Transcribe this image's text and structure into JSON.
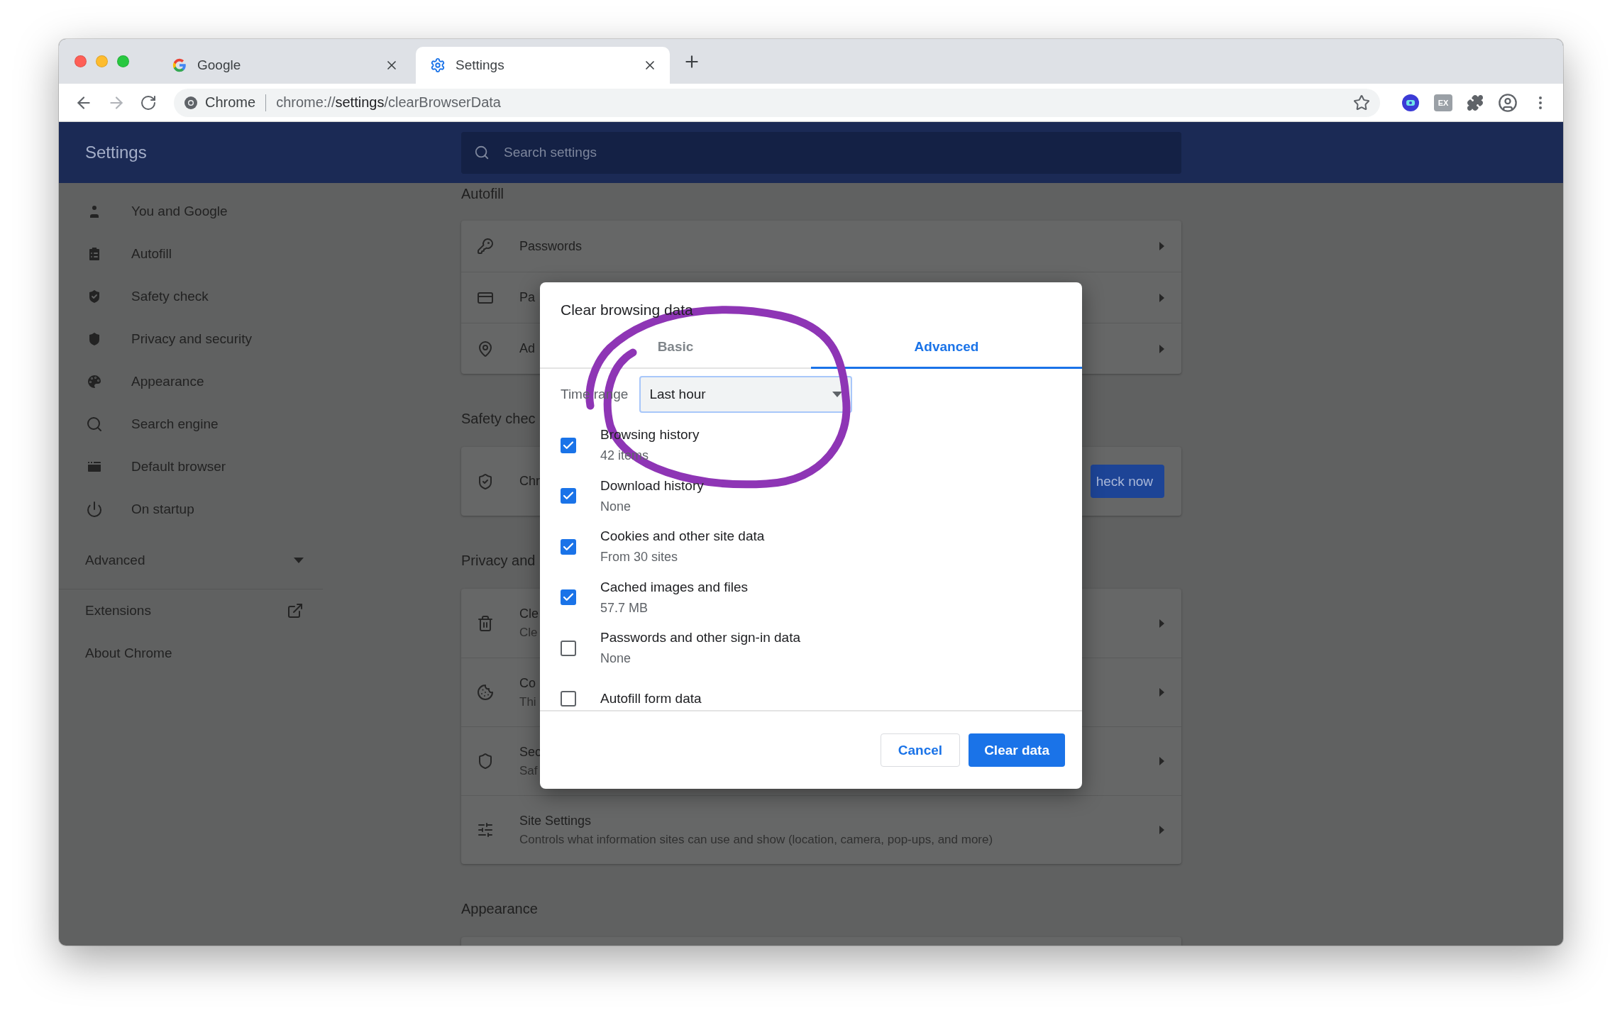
{
  "browser": {
    "tabs": [
      {
        "title": "Google",
        "selected": false
      },
      {
        "title": "Settings",
        "selected": true
      }
    ],
    "omnibox": {
      "chip": "Chrome",
      "url": {
        "scheme": "chrome://",
        "host": "settings",
        "path": "/clearBrowserData"
      }
    },
    "extension_badge": "EX"
  },
  "header": {
    "title": "Settings",
    "search": {
      "placeholder": "Search settings"
    }
  },
  "sidebar": {
    "items": [
      "You and Google",
      "Autofill",
      "Safety check",
      "Privacy and security",
      "Appearance",
      "Search engine",
      "Default browser",
      "On startup"
    ],
    "advanced": {
      "label": "Advanced",
      "expanded": false
    },
    "links": [
      "Extensions",
      "About Chrome"
    ]
  },
  "sections": [
    {
      "heading": "Autofill",
      "rows": [
        {
          "title": "Passwords"
        },
        {
          "title": "Pa"
        },
        {
          "title": "Ad"
        }
      ]
    },
    {
      "heading": "Safety chec",
      "rows": [
        {
          "title": "Chr",
          "button": "heck now"
        }
      ]
    },
    {
      "heading": "Privacy and",
      "rows": [
        {
          "title": "Cle",
          "subtitle": "Cle"
        },
        {
          "title": "Co",
          "subtitle": "Thi"
        },
        {
          "title": "Sec",
          "subtitle": "Saf"
        },
        {
          "title": "Site Settings",
          "subtitle": "Controls what information sites can use and show (location, camera, pop-ups, and more)"
        }
      ]
    },
    {
      "heading": "Appearance"
    }
  ],
  "dialog": {
    "title": "Clear browsing data",
    "tabs": [
      {
        "label": "Basic",
        "selected": false
      },
      {
        "label": "Advanced",
        "selected": true
      }
    ],
    "time_range": {
      "label": "Time range",
      "value": "Last hour"
    },
    "items": [
      {
        "label": "Browsing history",
        "detail": "42 items",
        "checked": true
      },
      {
        "label": "Download history",
        "detail": "None",
        "checked": true
      },
      {
        "label": "Cookies and other site data",
        "detail": "From 30 sites",
        "checked": true
      },
      {
        "label": "Cached images and files",
        "detail": "57.7 MB",
        "checked": true
      },
      {
        "label": "Passwords and other sign-in data",
        "detail": "None",
        "checked": false
      },
      {
        "label": "Autofill form data",
        "checked": false
      }
    ],
    "buttons": {
      "cancel": "Cancel",
      "confirm": "Clear data"
    }
  }
}
